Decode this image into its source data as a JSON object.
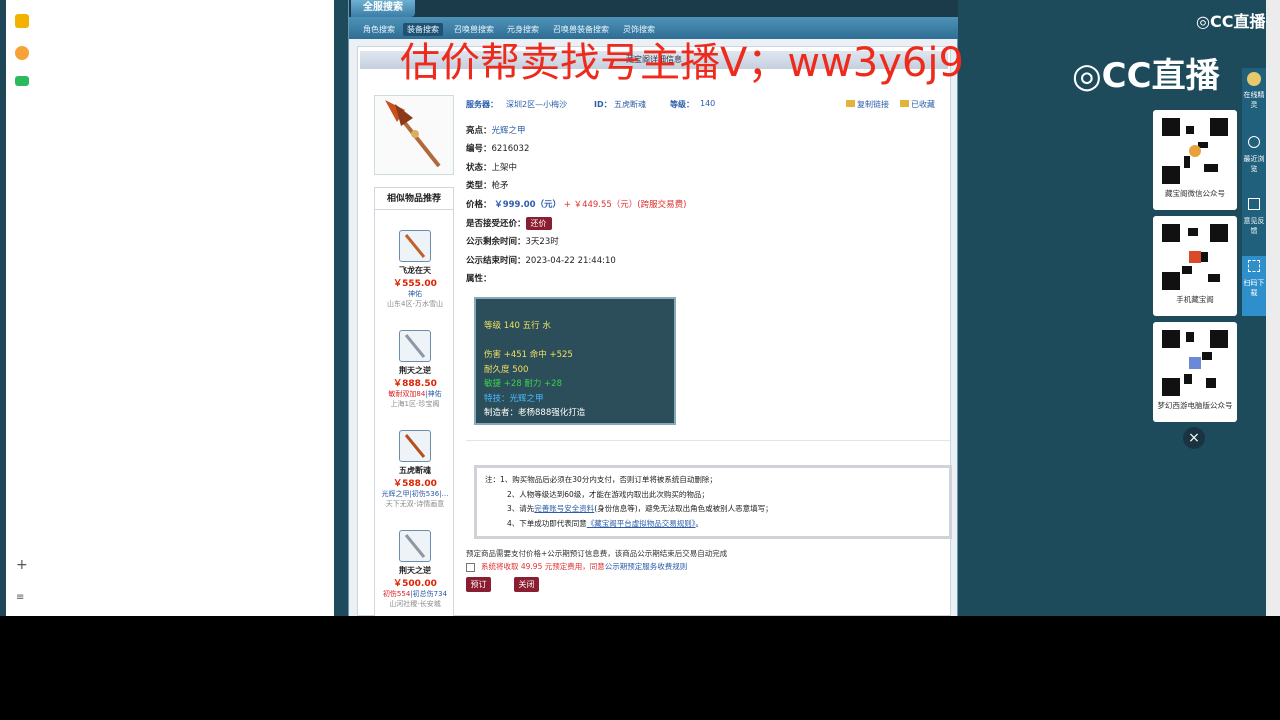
{
  "game": {
    "title_tab": "全服搜索",
    "menu": [
      "角色搜索",
      "装备搜索",
      "召唤兽搜索",
      "元身搜索",
      "召唤兽装备搜索",
      "灵饰搜索"
    ],
    "detail_header": "藏宝阁详细信息"
  },
  "watermark": "估价帮卖找号主播V；ww3y6j9",
  "item": {
    "server_label": "服务器：",
    "server_value": "深圳2区—小梅沙",
    "id_label": "ID：",
    "id_value": "五虎断魂",
    "level_label": "等级：",
    "level_value": "140",
    "copy_link": "复制链接",
    "favorited": "已收藏",
    "highlight_label": "亮点：",
    "highlight_value": "光辉之甲",
    "number_label": "编号：",
    "number_value": "6216032",
    "status_label": "状态：",
    "status_value": "上架中",
    "type_label": "类型：",
    "type_value": "枪矛",
    "price_label": "价格：",
    "price_value": "￥999.00（元）",
    "price_plus": "+",
    "price_fee": "￥449.55（元）(跨服交易费)",
    "counter_label": "是否接受还价：",
    "counter_button": "还价",
    "remain_label": "公示剩余时间：",
    "remain_value": "3天23时",
    "end_label": "公示结束时间：",
    "end_value": "2023-04-22 21:44:10",
    "attr_label": "属性："
  },
  "attributes": {
    "line1": "等级 140  五行 水",
    "line2": "伤害 +451 命中 +525",
    "line3": "耐久度 500",
    "line4": "敏捷 +28 耐力 +28",
    "line5": "特技：光辉之甲",
    "line6": "制造者：老杨888强化打造"
  },
  "similar": {
    "title": "相似物品推荐",
    "items": [
      {
        "name": "飞龙在天",
        "price": "￥555.00",
        "tag": "神佑",
        "tag_red": "",
        "server": "山东4区-万水雪山"
      },
      {
        "name": "荆天之逆",
        "price": "￥888.50",
        "tag": "|神佑",
        "tag_red": "敏耐双加84",
        "server": "上海1区-珍宝阁"
      },
      {
        "name": "五虎断魂",
        "price": "￥588.00",
        "tag": "光辉之甲|初伤536|…",
        "tag_red": "",
        "server": "天下无双-诗情画意"
      },
      {
        "name": "荆天之逆",
        "price": "￥500.00",
        "tag": "|初总伤734",
        "tag_red": "初伤554",
        "server": "山河社稷-长安城"
      }
    ]
  },
  "notice": {
    "l1": "注：1、购买物品后必须在30分内支付，否则订单将被系统自动删除；",
    "l2": "2、人物等级达到60级，才能在游戏内取出此次购买的物品；",
    "l3a": "3、请先",
    "l3link": "完善账号安全资料",
    "l3b": "(身份信息等)，避免无法取出角色或被别人恶意填写；",
    "l4a": "4、下单成功即代表同意",
    "l4link": "《藏宝阁平台虚拟物品交易规则》",
    "l4b": "。"
  },
  "order": {
    "note": "预定商品需要支付价格+公示期预订信息费，该商品公示期结束后交易自动完成",
    "agree_text": "系统将收取 49.95 元预定费用，同意",
    "agree_link": "公示期预定服务收费规则",
    "reserve": "预订",
    "close": "关闭"
  },
  "cc": {
    "brand_small": "CC直播",
    "brand_big": "CC直播",
    "qr1_label": "藏宝阁微信公众号",
    "qr2_label": "手机藏宝阁",
    "qr3_label": "梦幻西游电脑版公众号",
    "close": "×",
    "rail": [
      "在线精灵",
      "最近浏览",
      "意见反馈",
      "扫码下载"
    ]
  },
  "colors": {
    "accent_red": "#8a1d30",
    "link_blue": "#2a5ca8",
    "watermark_red": "#ee2a1c"
  }
}
